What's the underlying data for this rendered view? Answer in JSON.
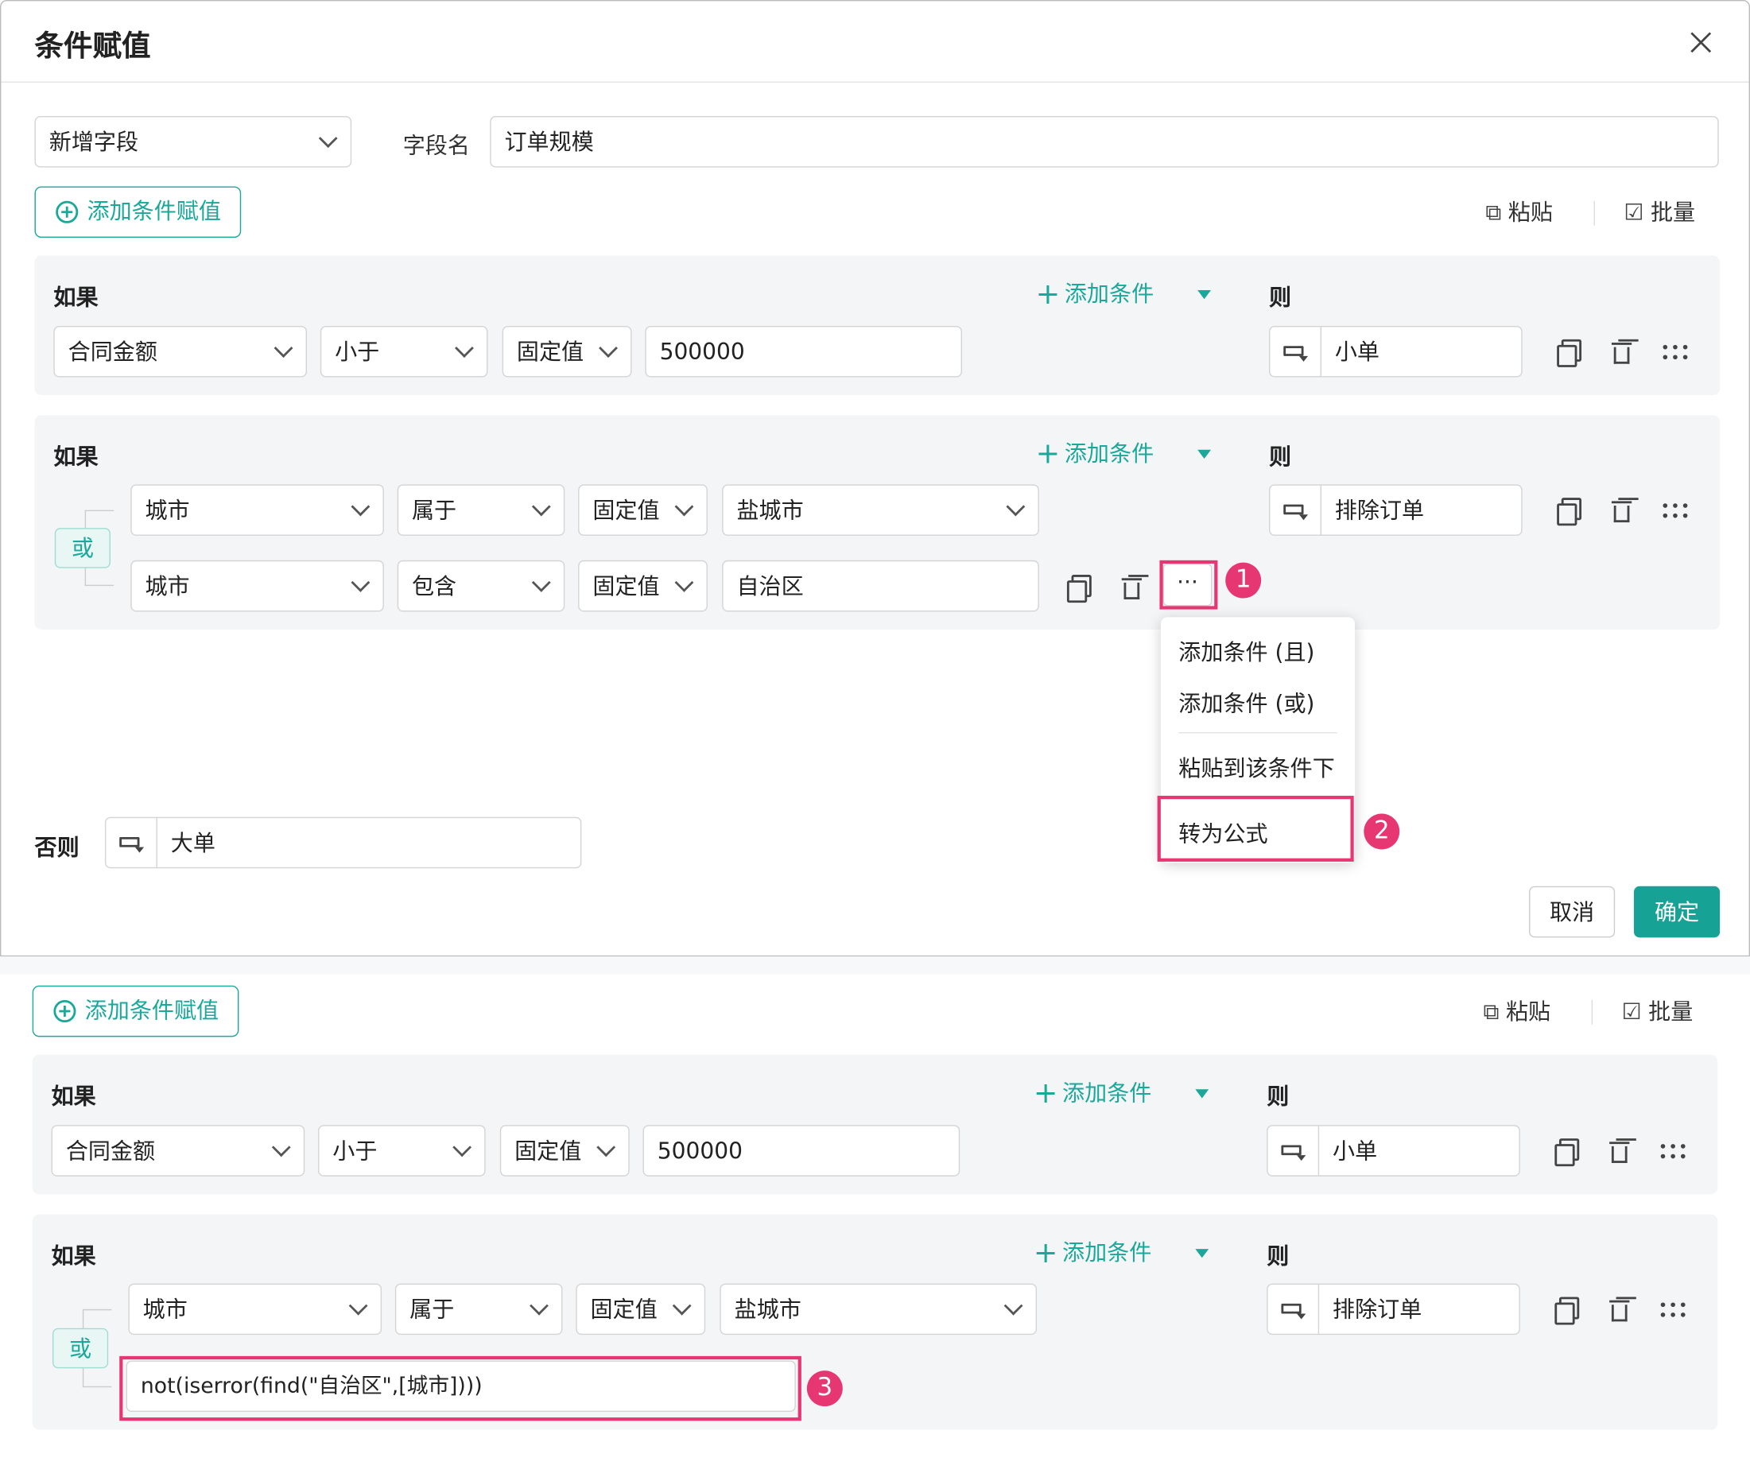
{
  "dialog": {
    "title": "条件赋值",
    "field_mode": "新增字段",
    "field_name_label": "字段名",
    "field_name_value": "订单规模",
    "add_cond_assign": "添加条件赋值",
    "paste": "粘贴",
    "batch": "批量",
    "if_label": "如果",
    "then_label": "则",
    "add_condition": "添加条件",
    "rule1": {
      "field": "合同金额",
      "op": "小于",
      "kind": "固定值",
      "value": "500000",
      "result": "小单"
    },
    "rule2": {
      "or_label": "或",
      "row1": {
        "field": "城市",
        "op": "属于",
        "kind": "固定值",
        "value": "盐城市"
      },
      "row2": {
        "field": "城市",
        "op": "包含",
        "kind": "固定值",
        "value": "自治区"
      },
      "result": "排除订单",
      "more": "···"
    },
    "menu": {
      "add_and": "添加条件 (且)",
      "add_or": "添加条件 (或)",
      "paste_under": "粘贴到该条件下",
      "to_formula": "转为公式"
    },
    "else_label": "否则",
    "else_value": "大单",
    "cancel": "取消",
    "ok": "确定"
  },
  "bottom": {
    "add_cond_assign": "添加条件赋值",
    "paste": "粘贴",
    "batch": "批量",
    "if_label": "如果",
    "then_label": "则",
    "add_condition": "添加条件",
    "rule1": {
      "field": "合同金额",
      "op": "小于",
      "kind": "固定值",
      "value": "500000",
      "result": "小单"
    },
    "rule2": {
      "or_label": "或",
      "field": "城市",
      "op": "属于",
      "kind": "固定值",
      "value": "盐城市",
      "formula": "not(iserror(find(\"自治区\",[城市])))",
      "result": "排除订单"
    }
  },
  "callouts": [
    "1",
    "2",
    "3"
  ],
  "colors": {
    "accent": "#1aa89a",
    "highlight": "#e63772",
    "primary_button": "#16a395"
  }
}
